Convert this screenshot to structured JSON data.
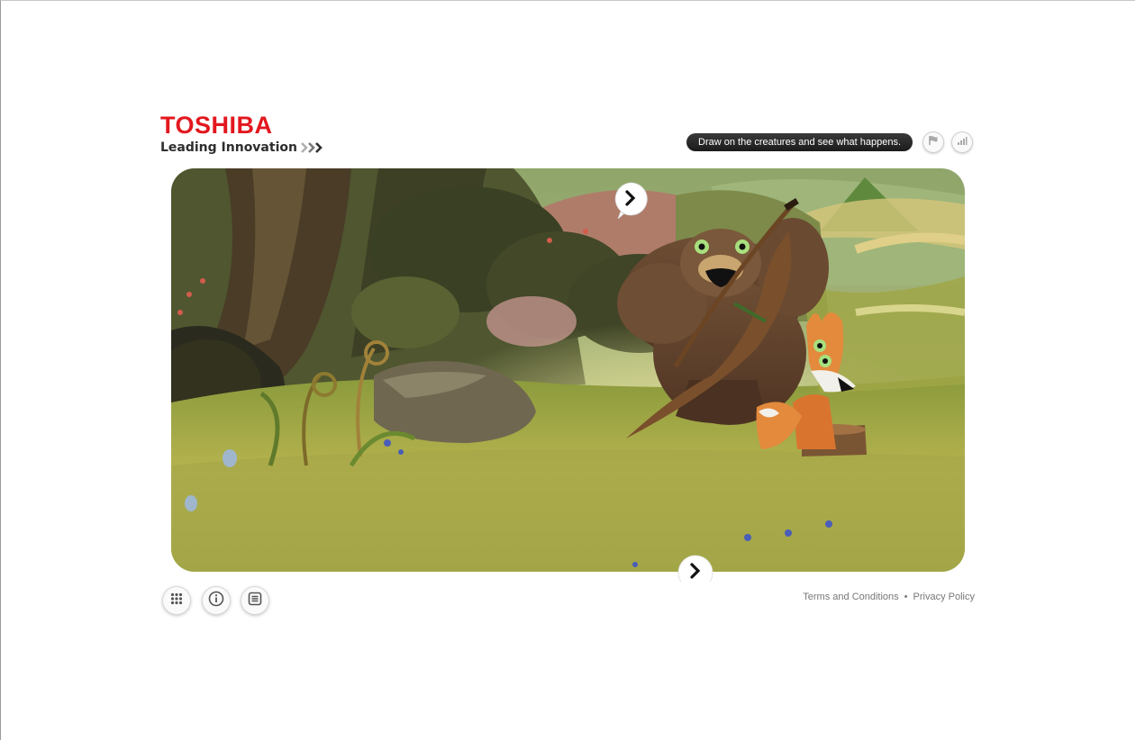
{
  "brand": {
    "name": "TOSHIBA",
    "tagline": "Leading Innovation",
    "color": "#e3171e"
  },
  "hint": {
    "text": "Draw on the creatures and see what happens."
  },
  "top_controls": [
    {
      "icon": "flag-icon"
    },
    {
      "icon": "signal-bars-icon"
    }
  ],
  "scene": {
    "characters": [
      "bear",
      "fox"
    ],
    "nav_icons": [
      "chevron-right-icon",
      "chevron-right-icon"
    ]
  },
  "bottom_controls": [
    {
      "icon": "grid-icon"
    },
    {
      "icon": "info-icon"
    },
    {
      "icon": "list-icon"
    }
  ],
  "footer": {
    "terms": "Terms and Conditions",
    "separator": "•",
    "privacy": "Privacy Policy"
  }
}
